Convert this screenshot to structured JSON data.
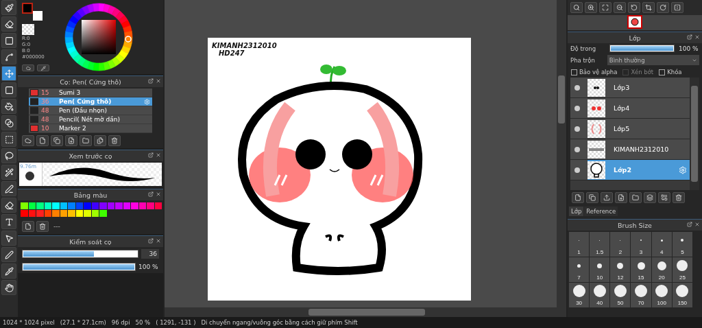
{
  "tools": [
    {
      "selected": false
    },
    {
      "selected": false
    },
    {
      "selected": false
    },
    {
      "selected": false
    },
    {
      "selected": true
    },
    {
      "selected": false
    },
    {
      "selected": false
    },
    {
      "selected": false
    },
    {
      "selected": false
    },
    {
      "selected": false
    },
    {
      "selected": false
    },
    {
      "selected": false
    },
    {
      "selected": false
    },
    {
      "selected": false
    },
    {
      "selected": false
    },
    {
      "selected": false
    },
    {
      "selected": false
    },
    {
      "selected": false
    }
  ],
  "color_panel": {
    "r": "R:0",
    "g": "G:0",
    "b": "B:0",
    "hex": "#000000"
  },
  "brush_panel": {
    "title": "Cọ: Pen( Cứng thô)",
    "brushes": [
      {
        "size": "15",
        "name": "Sumi 3",
        "color": "#e03030",
        "selected": false
      },
      {
        "size": "36",
        "name": "Pen( Cứng thô)",
        "color": "#222222",
        "selected": true
      },
      {
        "size": "48",
        "name": "Pen (Đầu nhọn)",
        "color": "#222222",
        "selected": false
      },
      {
        "size": "48",
        "name": "Pencil( Nét mờ dần)",
        "color": "#222222",
        "selected": false
      },
      {
        "size": "10",
        "name": "Marker 2",
        "color": "#e03030",
        "selected": false
      }
    ]
  },
  "preview_panel": {
    "title": "Xem trước cọ",
    "size": "9.76m"
  },
  "palette_panel": {
    "title": "Bảng màu",
    "swatches": [
      {
        "color": "#80ff00"
      },
      {
        "color": "#00ff40"
      },
      {
        "color": "#00ff80"
      },
      {
        "color": "#00ffc0"
      },
      {
        "color": "#00ffff"
      },
      {
        "color": "#00c0ff"
      },
      {
        "color": "#0080ff"
      },
      {
        "color": "#0040ff"
      },
      {
        "color": "#0000ff"
      },
      {
        "color": "#4000ff"
      },
      {
        "color": "#8000ff"
      },
      {
        "color": "#a000ff"
      },
      {
        "color": "#c000ff"
      },
      {
        "color": "#e000ff"
      },
      {
        "color": "#ff00e0"
      },
      {
        "color": "#ff00b0"
      },
      {
        "color": "#ff0080"
      },
      {
        "color": "#ff0040"
      },
      {
        "color": "#ff0000"
      },
      {
        "color": "#ff1010"
      },
      {
        "color": "#ff2020"
      },
      {
        "color": "#ff4000"
      },
      {
        "color": "#ff8000"
      },
      {
        "color": "#ffa000"
      },
      {
        "color": "#ffc000"
      },
      {
        "color": "#ffff00"
      },
      {
        "color": "#e0ff00"
      },
      {
        "color": "#a0ff00"
      },
      {
        "color": "#40ff00"
      }
    ],
    "separator": "---"
  },
  "brush_control": {
    "title": "Kiểm soát cọ",
    "size": {
      "level": 0.62,
      "value": "36"
    },
    "opacity": {
      "level": 1,
      "reading": "100 %"
    }
  },
  "canvas": {
    "texts": [
      "KIMANH2312010",
      "HD247"
    ]
  },
  "layer_panel": {
    "title": "Lớp",
    "opacity_label": "Độ trong",
    "opacity": {
      "level": 1,
      "reading": "100 %"
    },
    "blend_label": "Pha trộn",
    "blend_value": "Bình thường",
    "options": [
      {
        "label": "Bảo vệ alpha",
        "checked": false,
        "disabled": false
      },
      {
        "label": "Xén bớt",
        "checked": false,
        "disabled": true
      },
      {
        "label": "Khóa",
        "checked": false,
        "disabled": false
      }
    ],
    "layers": [
      {
        "name": "Lớp3",
        "kind": "eyes",
        "selected": false
      },
      {
        "name": "Lớp4",
        "kind": "blush",
        "selected": false
      },
      {
        "name": "Lớp5",
        "kind": "shade",
        "selected": false
      },
      {
        "name": "KIMANH2312010",
        "kind": "text",
        "selected": false
      },
      {
        "name": "Lớp2",
        "kind": "outline",
        "selected": true
      }
    ],
    "tabs": [
      {
        "label": "Lớp",
        "selected": true
      },
      {
        "label": "Reference",
        "selected": false
      }
    ]
  },
  "brush_size_panel": {
    "title": "Brush Size",
    "sizes": [
      "1",
      "1.5",
      "2",
      "3",
      "4",
      "5",
      "7",
      "10",
      "12",
      "15",
      "20",
      "25",
      "30",
      "40",
      "50",
      "70",
      "100",
      "150"
    ]
  },
  "status_bar": {
    "pixels": "1024 * 1024 pixel",
    "physical": "(27.1 * 27.1cm)",
    "dpi": "96 dpi",
    "zoom": "50 %",
    "position": "( 1291, -131 )",
    "hint": "Di chuyển ngang/vuông góc bằng cách giữ phím Shift"
  }
}
